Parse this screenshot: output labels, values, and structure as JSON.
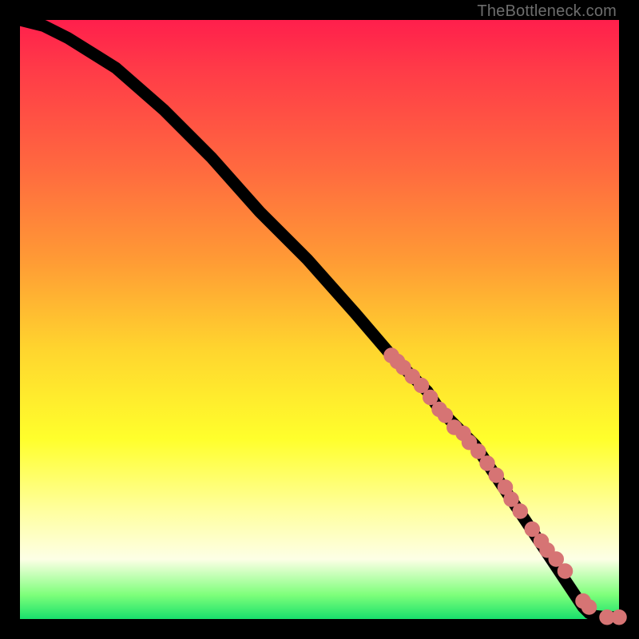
{
  "attribution": "TheBottleneck.com",
  "colors": {
    "background": "#000000",
    "gradient_stops": [
      "#ff1f4c",
      "#ff3a48",
      "#ff6a3f",
      "#ff9a35",
      "#ffd52e",
      "#ffff2c",
      "#ffffa0",
      "#fdffe6",
      "#7dff7a",
      "#18e06c"
    ],
    "curve": "#000000",
    "markers": "#d67474"
  },
  "chart_data": {
    "type": "line",
    "title": "",
    "xlabel": "",
    "ylabel": "",
    "xlim": [
      0,
      100
    ],
    "ylim": [
      0,
      100
    ],
    "grid": false,
    "legend": false,
    "series": [
      {
        "name": "bottleneck-curve",
        "x": [
          0,
          4,
          8,
          16,
          24,
          32,
          40,
          48,
          56,
          62,
          64,
          66,
          68,
          70,
          72,
          74,
          76,
          78,
          80,
          82,
          84,
          86,
          88,
          90,
          92,
          94,
          95,
          96,
          98,
          100
        ],
        "y": [
          100,
          99,
          97,
          92,
          85,
          77,
          68,
          60,
          51,
          44,
          42,
          40,
          38,
          35,
          33,
          31,
          29,
          26,
          23,
          20,
          17,
          14,
          11,
          8,
          5,
          2,
          1,
          0.5,
          0.3,
          0.3
        ]
      }
    ],
    "markers": {
      "name": "highlighted-range",
      "x": [
        62,
        63,
        64,
        65.5,
        67,
        68.5,
        70,
        71,
        72.5,
        74,
        75,
        76.5,
        78,
        79.5,
        81,
        82,
        83.5,
        85.5,
        87,
        88,
        89.5,
        91,
        94,
        95,
        98,
        100
      ],
      "y": [
        44,
        43,
        42,
        40.5,
        39,
        37,
        35,
        34,
        32,
        31,
        29.5,
        28,
        26,
        24,
        22,
        20,
        18,
        15,
        13,
        11.5,
        10,
        8,
        3,
        2,
        0.3,
        0.3
      ],
      "r": 6
    }
  }
}
